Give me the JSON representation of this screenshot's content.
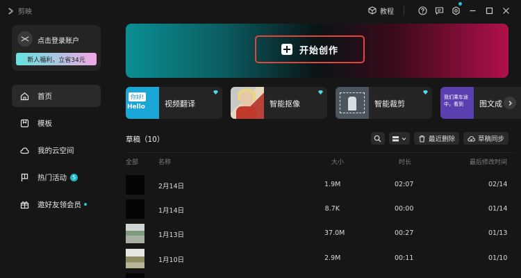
{
  "app": {
    "name": "剪映"
  },
  "titlebar": {
    "tutorial_label": "教程",
    "icons": [
      "help-icon",
      "feedback-icon",
      "settings-icon",
      "minimize-icon",
      "maximize-icon",
      "close-icon"
    ],
    "accent": "#21c7d6"
  },
  "sidebar": {
    "login": {
      "label": "点击登录账户",
      "promo": "新人福利，立省34元"
    },
    "items": [
      {
        "label": "首页",
        "icon": "home-icon",
        "active": true
      },
      {
        "label": "模板",
        "icon": "template-icon"
      },
      {
        "label": "我的云空间",
        "icon": "cloud-icon"
      },
      {
        "label": "热门活动",
        "icon": "flag-icon",
        "badge": "5"
      },
      {
        "label": "邀好友领会员",
        "icon": "gift-icon",
        "dot": true
      }
    ]
  },
  "hero": {
    "create_label": "开始创作",
    "highlight_color": "#e0473a"
  },
  "tools": [
    {
      "label": "视频翻译",
      "thumb_text_1": "你好!",
      "thumb_text_2": "Hello"
    },
    {
      "label": "智能抠像"
    },
    {
      "label": "智能裁剪"
    },
    {
      "label": "图文成",
      "thumb_text": "我们乘车途中，看到"
    }
  ],
  "drafts": {
    "title": "草稿（10）",
    "actions": {
      "recent_delete": "最近删除",
      "sync": "草稿同步"
    },
    "columns": {
      "all": "全部",
      "name": "名称",
      "size": "大小",
      "duration": "时长",
      "modified": "最后修改时间"
    },
    "rows": [
      {
        "name": "2月14日",
        "size": "1.9M",
        "duration": "02:07",
        "modified": "02/14",
        "thumb": "black"
      },
      {
        "name": "1月14日",
        "size": "8.7K",
        "duration": "00:00",
        "modified": "01/14",
        "thumb": "black"
      },
      {
        "name": "1月13日",
        "size": "37.0M",
        "duration": "00:27",
        "modified": "01/13",
        "thumb": "photo1"
      },
      {
        "name": "1月10日",
        "size": "2.9M",
        "duration": "00:11",
        "modified": "01/10",
        "thumb": "photo2"
      }
    ]
  }
}
